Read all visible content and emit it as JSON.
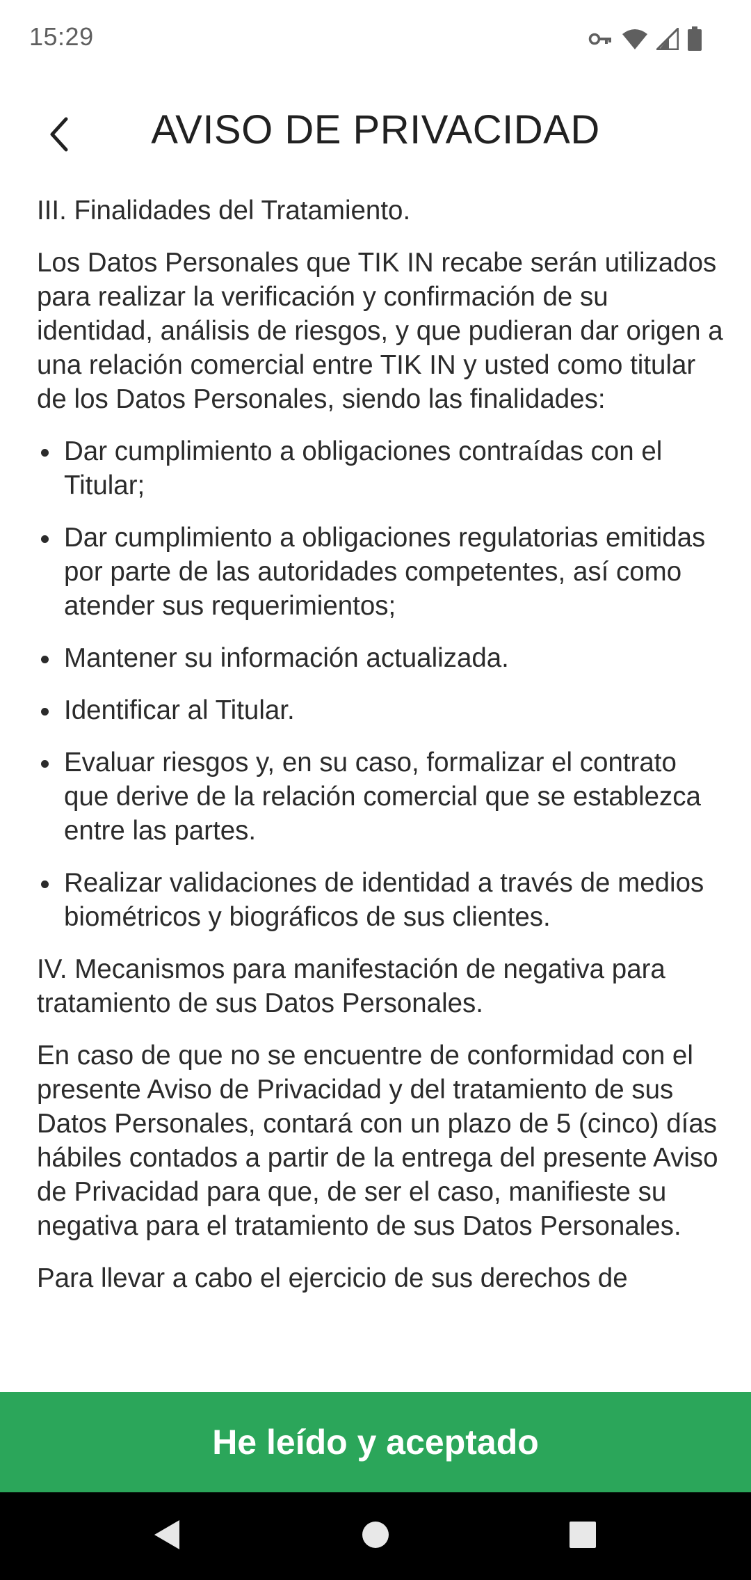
{
  "status_bar": {
    "time": "15:29",
    "icons": [
      "vpn-key-icon",
      "wifi-icon",
      "cellular-signal-icon",
      "battery-icon"
    ]
  },
  "app_bar": {
    "back_icon": "chevron-left-icon",
    "title": "AVISO DE PRIVACIDAD"
  },
  "content": {
    "section3_heading": "III. Finalidades del Tratamiento.",
    "section3_intro": "Los Datos Personales que TIK IN recabe serán utilizados para realizar la verificación y confirmación de su identidad, análisis de riesgos, y que pudieran dar origen a una relación comercial entre TIK IN y usted como titular de los Datos Personales, siendo las finalidades:",
    "purposes": [
      "Dar cumplimiento a obligaciones contraídas con el Titular;",
      "Dar cumplimiento a obligaciones regulatorias emitidas por parte de las autoridades competentes, así como atender sus requerimientos;",
      "Mantener su información actualizada.",
      "Identificar al Titular.",
      "Evaluar riesgos y, en su caso, formalizar el contrato que derive de la relación comercial que se establezca entre las partes.",
      "Realizar validaciones de identidad a través de medios biométricos y biográficos de sus clientes."
    ],
    "section4_heading": "IV. Mecanismos para manifestación de negativa para tratamiento de sus Datos Personales.",
    "section4_body": "En caso de que no se encuentre de conformidad con el presente Aviso de Privacidad y del tratamiento de sus Datos Personales, contará con un plazo de 5 (cinco) días hábiles contados a partir de la entrega del presente Aviso de Privacidad para que, de ser el caso, manifieste su negativa para el tratamiento de sus Datos Personales.",
    "section4_continuation": "Para llevar a cabo el ejercicio de sus derechos de"
  },
  "accept_button": {
    "label": "He leído y aceptado",
    "color": "#2ba65a"
  },
  "nav_bar": {
    "icons": [
      "nav-back-icon",
      "nav-home-icon",
      "nav-recents-icon"
    ]
  }
}
